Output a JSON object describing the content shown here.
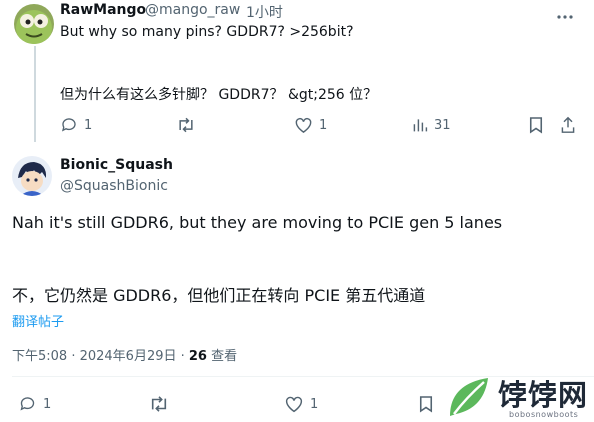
{
  "tweet1": {
    "display_name": "RawMango",
    "handle": "@mango_raw",
    "sep": "·",
    "time": "1小时",
    "text_en": "But why so many pins? GDDR7? >256bit?",
    "text_zh": "但为什么有这么多针脚？ GDDR7？ &gt;256 位？",
    "actions": {
      "reply_count": "1",
      "like_count": "1",
      "view_count": "31"
    }
  },
  "tweet2": {
    "display_name": "Bionic_Squash",
    "handle": "@SquashBionic",
    "text_en": "Nah it's still GDDR6, but they are moving to PCIE gen 5 lanes",
    "text_zh": "不，它仍然是 GDDR6，但他们正在转向 PCIE 第五代通道",
    "translate_label": "翻译帖子",
    "meta": {
      "time": "下午5:08 · 2024年6月29日 · ",
      "views": "26",
      "views_label": " 查看"
    },
    "actions": {
      "reply_count": "1",
      "like_count": "1"
    }
  },
  "watermark": {
    "brand": "饽饽网",
    "sub": "bobosnowboots"
  }
}
